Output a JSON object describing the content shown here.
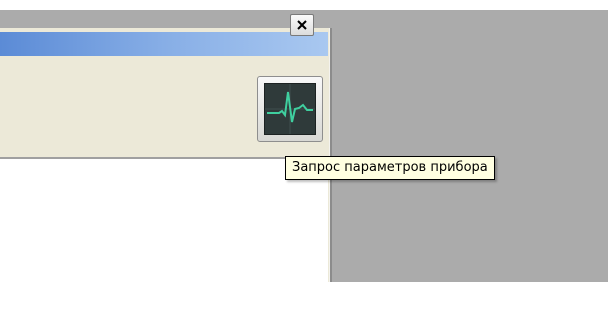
{
  "window": {
    "close_icon": "close-icon",
    "toolbar": {
      "device_params_button": {
        "icon": "heartbeat-monitor-icon",
        "tooltip": "Запрос параметров прибора"
      }
    }
  },
  "colors": {
    "titlebar_start": "#5b8bd6",
    "titlebar_end": "#a9c8f0",
    "background": "#ababab",
    "tooltip_bg": "#ffffe1",
    "pulse_line": "#3fcf9f"
  }
}
